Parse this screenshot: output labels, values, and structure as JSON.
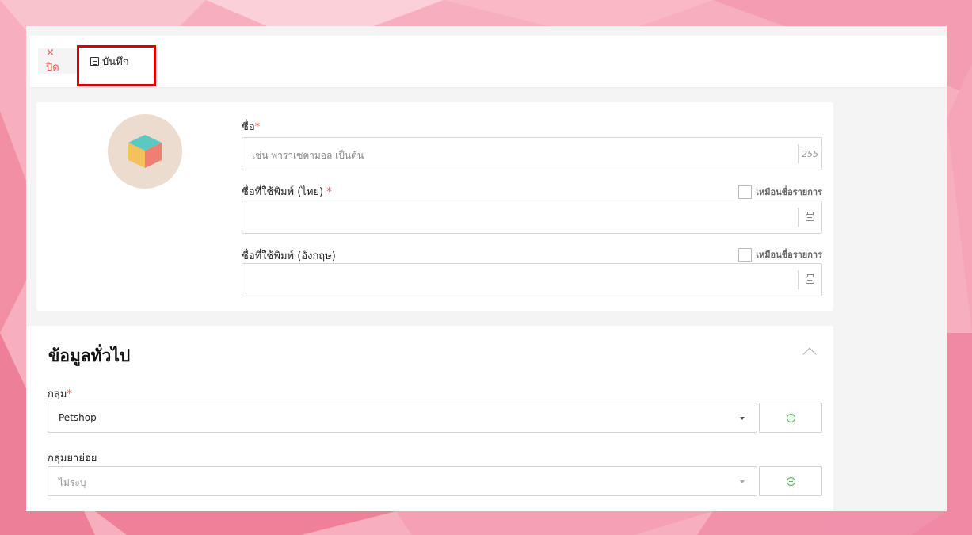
{
  "toolbar": {
    "close_label": "× ปิด",
    "save_label": "บันทึก"
  },
  "item": {
    "name_label": "ชื่อ",
    "name_placeholder": "เช่น พาราเซตามอล เป็นต้น",
    "name_max_length": "255",
    "print_name_th_label": "ชื่อที่ใช้พิมพ์ (ไทย)",
    "print_name_en_label": "ชื่อที่ใช้พิมพ์ (อังกฤษ)",
    "same_as_name_label": "เหมือนชื่อรายการ",
    "required_mark": "*"
  },
  "general": {
    "title": "ข้อมูลทั่วไป",
    "group_label": "กลุ่ม",
    "group_value": "Petshop",
    "subgroup_label": "กลุ่มยาย่อย",
    "subgroup_value": "ไม่ระบุ"
  },
  "colors": {
    "accent_red": "#e2574c",
    "add_green": "#4fb35a",
    "highlight": "#d90000",
    "background_pink": "#f6a3b4"
  },
  "icons": {
    "close": "close-icon",
    "save": "save-icon",
    "printer": "printer-icon",
    "collapse": "chevron-up-icon",
    "add": "plus-circle-icon",
    "dropdown": "caret-down-icon"
  }
}
